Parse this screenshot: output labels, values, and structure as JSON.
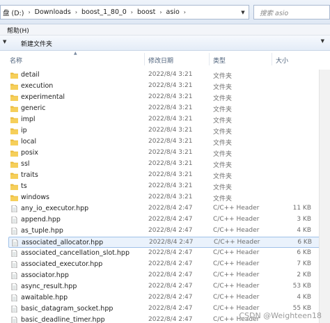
{
  "address": {
    "drive_fragment": "盘 (D:)",
    "crumbs": [
      "Downloads",
      "boost_1_80_0",
      "boost",
      "asio"
    ],
    "search_placeholder": "搜索 asio"
  },
  "menu": {
    "help": "帮助(H)"
  },
  "toolbar": {
    "new_folder": "新建文件夹"
  },
  "columns": {
    "name": "名称",
    "modified": "修改日期",
    "type": "类型",
    "size": "大小"
  },
  "files": [
    {
      "name": "detail",
      "date": "2022/8/4 3:21",
      "type": "文件夹",
      "size": "",
      "kind": "folder"
    },
    {
      "name": "execution",
      "date": "2022/8/4 3:21",
      "type": "文件夹",
      "size": "",
      "kind": "folder"
    },
    {
      "name": "experimental",
      "date": "2022/8/4 3:21",
      "type": "文件夹",
      "size": "",
      "kind": "folder"
    },
    {
      "name": "generic",
      "date": "2022/8/4 3:21",
      "type": "文件夹",
      "size": "",
      "kind": "folder"
    },
    {
      "name": "impl",
      "date": "2022/8/4 3:21",
      "type": "文件夹",
      "size": "",
      "kind": "folder"
    },
    {
      "name": "ip",
      "date": "2022/8/4 3:21",
      "type": "文件夹",
      "size": "",
      "kind": "folder"
    },
    {
      "name": "local",
      "date": "2022/8/4 3:21",
      "type": "文件夹",
      "size": "",
      "kind": "folder"
    },
    {
      "name": "posix",
      "date": "2022/8/4 3:21",
      "type": "文件夹",
      "size": "",
      "kind": "folder"
    },
    {
      "name": "ssl",
      "date": "2022/8/4 3:21",
      "type": "文件夹",
      "size": "",
      "kind": "folder"
    },
    {
      "name": "traits",
      "date": "2022/8/4 3:21",
      "type": "文件夹",
      "size": "",
      "kind": "folder"
    },
    {
      "name": "ts",
      "date": "2022/8/4 3:21",
      "type": "文件夹",
      "size": "",
      "kind": "folder"
    },
    {
      "name": "windows",
      "date": "2022/8/4 3:21",
      "type": "文件夹",
      "size": "",
      "kind": "folder"
    },
    {
      "name": "any_io_executor.hpp",
      "date": "2022/8/4 2:47",
      "type": "C/C++ Header",
      "size": "11 KB",
      "kind": "file"
    },
    {
      "name": "append.hpp",
      "date": "2022/8/4 2:47",
      "type": "C/C++ Header",
      "size": "3 KB",
      "kind": "file"
    },
    {
      "name": "as_tuple.hpp",
      "date": "2022/8/4 2:47",
      "type": "C/C++ Header",
      "size": "4 KB",
      "kind": "file"
    },
    {
      "name": "associated_allocator.hpp",
      "date": "2022/8/4 2:47",
      "type": "C/C++ Header",
      "size": "6 KB",
      "kind": "file",
      "selected": true
    },
    {
      "name": "associated_cancellation_slot.hpp",
      "date": "2022/8/4 2:47",
      "type": "C/C++ Header",
      "size": "6 KB",
      "kind": "file"
    },
    {
      "name": "associated_executor.hpp",
      "date": "2022/8/4 2:47",
      "type": "C/C++ Header",
      "size": "7 KB",
      "kind": "file"
    },
    {
      "name": "associator.hpp",
      "date": "2022/8/4 2:47",
      "type": "C/C++ Header",
      "size": "2 KB",
      "kind": "file"
    },
    {
      "name": "async_result.hpp",
      "date": "2022/8/4 2:47",
      "type": "C/C++ Header",
      "size": "53 KB",
      "kind": "file"
    },
    {
      "name": "awaitable.hpp",
      "date": "2022/8/4 2:47",
      "type": "C/C++ Header",
      "size": "4 KB",
      "kind": "file"
    },
    {
      "name": "basic_datagram_socket.hpp",
      "date": "2022/8/4 2:47",
      "type": "C/C++ Header",
      "size": "55 KB",
      "kind": "file"
    },
    {
      "name": "basic_deadline_timer.hpp",
      "date": "2022/8/4 2:47",
      "type": "C/C++ Header",
      "size": "",
      "kind": "file"
    }
  ],
  "watermark": "CSDN @Weighteen18"
}
